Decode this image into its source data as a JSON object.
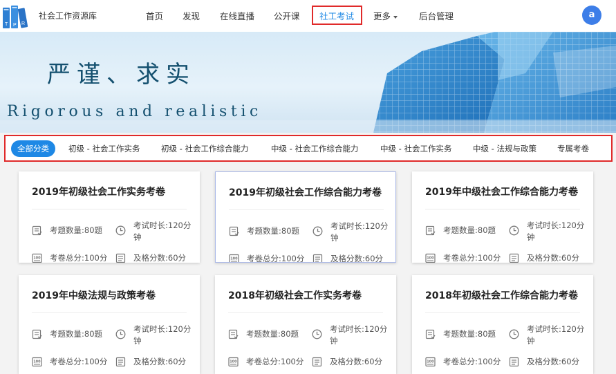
{
  "site": {
    "name": "社会工作资源库",
    "logo_letters": [
      "T",
      "P",
      "R"
    ]
  },
  "nav": {
    "items": [
      "首页",
      "发现",
      "在线直播",
      "公开课",
      "社工考试",
      "更多",
      "后台管理"
    ],
    "active_index": 4,
    "avatar_letter": "a"
  },
  "banner": {
    "title": "严谨、求实",
    "subtitle": "Rigorous and realistic"
  },
  "categories": {
    "items": [
      "全部分类",
      "初级 - 社会工作实务",
      "初级 - 社会工作综合能力",
      "中级 - 社会工作综合能力",
      "中级 - 社会工作实务",
      "中级 - 法规与政策",
      "专属考卷"
    ],
    "active_index": 0
  },
  "cards": [
    {
      "title": "2019年初级社会工作实务考卷",
      "count": "考题数量:80题",
      "duration": "考试时长:120分钟",
      "total": "考卷总分:100分",
      "pass": "及格分数:60分"
    },
    {
      "title": "2019年初级社会工作综合能力考卷",
      "count": "考题数量:80题",
      "duration": "考试时长:120分钟",
      "total": "考卷总分:100分",
      "pass": "及格分数:60分"
    },
    {
      "title": "2019年中级社会工作综合能力考卷",
      "count": "考题数量:80题",
      "duration": "考试时长:120分钟",
      "total": "考卷总分:100分",
      "pass": "及格分数:60分"
    },
    {
      "title": "2019年中级法规与政策考卷",
      "count": "考题数量:80题",
      "duration": "考试时长:120分钟",
      "total": "考卷总分:100分",
      "pass": "及格分数:60分"
    },
    {
      "title": "2018年初级社会工作实务考卷",
      "count": "考题数量:80题",
      "duration": "考试时长:120分钟",
      "total": "考卷总分:100分",
      "pass": "及格分数:60分"
    },
    {
      "title": "2018年初级社会工作综合能力考卷",
      "count": "考题数量:80题",
      "duration": "考试时长:120分钟",
      "total": "考卷总分:100分",
      "pass": "及格分数:60分"
    }
  ],
  "colors": {
    "accent": "#1e88e5",
    "highlight_box": "#e02a2a",
    "avatar": "#3d7ee8"
  }
}
